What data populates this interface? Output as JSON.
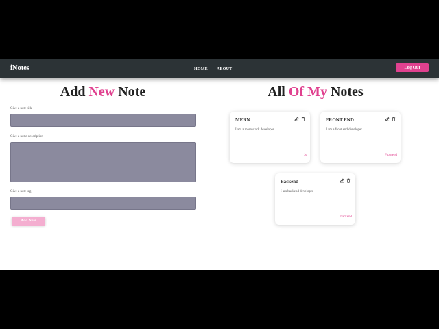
{
  "navbar": {
    "brand": "iNotes",
    "links": [
      {
        "label": "HOME"
      },
      {
        "label": "ABOUT"
      }
    ],
    "logout_label": "Log Out"
  },
  "add_note": {
    "title_part1": "Add",
    "title_accent": "New",
    "title_part2": "Note",
    "title_label": "Give a note title",
    "title_value": "",
    "description_label": "Give a notte description",
    "description_value": "",
    "tag_label": "Give a note tag",
    "tag_value": "",
    "button_label": "Add Note"
  },
  "notes_section": {
    "title_part1": "All",
    "title_accent": "Of My",
    "title_part2": "Notes"
  },
  "notes": [
    {
      "title": "MERN",
      "description": "I am a mern stack developer",
      "tag": "Js"
    },
    {
      "title": "FRONT END",
      "description": "I am a front end developer",
      "tag": "Frontend"
    },
    {
      "title": "Backend",
      "description": "I am backend developer",
      "tag": "backend"
    }
  ],
  "colors": {
    "accent": "#e0418f",
    "navbar_bg": "#2c3336",
    "input_bg": "#8b8a9e",
    "add_button_bg": "#f4aed0"
  },
  "icons": {
    "edit": "pencil-icon",
    "delete": "trash-icon"
  }
}
